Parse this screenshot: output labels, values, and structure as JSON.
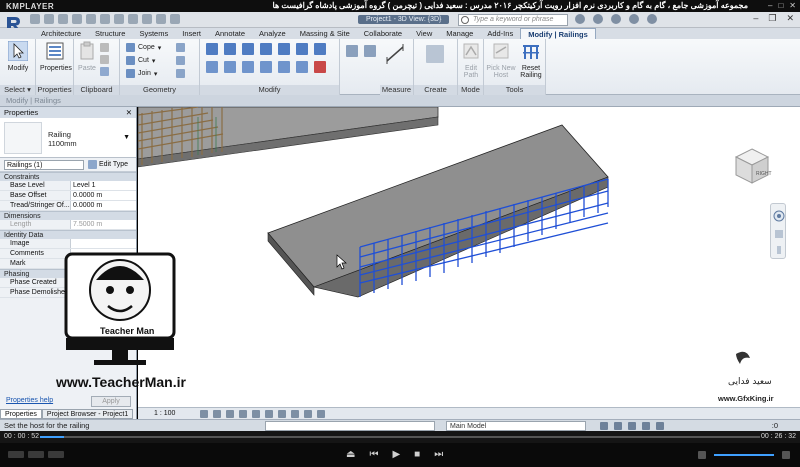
{
  "player": {
    "logo": "KMPLAYER",
    "caption": "مجموعه آموزشی جامع ، گام به گام و کاربردی نرم افزار رویت آرکیتکچر ۲۰۱۶   مدرس : سعید فدایی ( تیچرمن ) گروه آموزشی پادشاه گرافیست ها",
    "time_current": "00 : 00 : 52",
    "time_total": "00 : 26 : 32",
    "progress_fraction": 0.033
  },
  "revit": {
    "doc_title": "Project1 - 3D View: {3D}",
    "search_placeholder": "Type a keyword or phrase",
    "tabs": [
      "Architecture",
      "Structure",
      "Systems",
      "Insert",
      "Annotate",
      "Analyze",
      "Massing & Site",
      "Collaborate",
      "View",
      "Manage",
      "Add-Ins"
    ],
    "context_tab": "Modify | Railings",
    "ribbon": {
      "select": {
        "button": "Modify",
        "label": "Select"
      },
      "properties": {
        "button": "Properties",
        "label": "Properties"
      },
      "clipboard": {
        "paste": "Paste",
        "label": "Clipboard"
      },
      "geometry": {
        "cope": "Cope",
        "cut": "Cut",
        "join": "Join",
        "label": "Geometry"
      },
      "modify": {
        "label": "Modify"
      },
      "measure": {
        "label": "Measure"
      },
      "create": {
        "label": "Create"
      },
      "mode": {
        "edit_path": "Edit Path",
        "label": "Mode"
      },
      "tools": {
        "pick_new_host": "Pick New Host",
        "reset_railing": "Reset Railing",
        "label": "Tools"
      }
    },
    "options_bar": "Modify | Railings"
  },
  "properties": {
    "title": "Properties",
    "type_family": "Railing",
    "type_name": "1100mm",
    "instance_filter": "Railings (1)",
    "edit_type": "Edit Type",
    "groups": {
      "constraints": "Constraints",
      "dimensions": "Dimensions",
      "identity": "Identity Data",
      "phasing": "Phasing"
    },
    "rows": {
      "base_level": {
        "name": "Base Level",
        "value": "Level 1"
      },
      "base_offset": {
        "name": "Base Offset",
        "value": "0.0000 m"
      },
      "tread_offset": {
        "name": "Tread/Stringer Of...",
        "value": "0.0000 m"
      },
      "length": {
        "name": "Length",
        "value": "7.5000 m"
      },
      "image": {
        "name": "Image",
        "value": ""
      },
      "comments": {
        "name": "Comments",
        "value": ""
      },
      "mark": {
        "name": "Mark",
        "value": ""
      },
      "phase_created": {
        "name": "Phase Created",
        "value": ""
      },
      "phase_demolished": {
        "name": "Phase Demolished",
        "value": ""
      }
    },
    "help_link": "Properties help",
    "apply": "Apply",
    "tab_properties": "Properties",
    "tab_browser": "Project Browser - Project1"
  },
  "viewbar": {
    "scale": "1 : 100"
  },
  "status": {
    "text": "Set the host for the railing",
    "model": "Main Model",
    "filter_count": ":0"
  },
  "watermarks": {
    "teacherman_url": "www.TeacherMan.ir",
    "teacherman_name": "Teacher Man",
    "gfx_url": "www.GfxKing.ir",
    "gfx_sign": "سعید فدایی"
  },
  "colors": {
    "railing_selected": "#1f4fd6",
    "railing_default": "#8a6d44",
    "floor_top": "#9a9a9a"
  }
}
